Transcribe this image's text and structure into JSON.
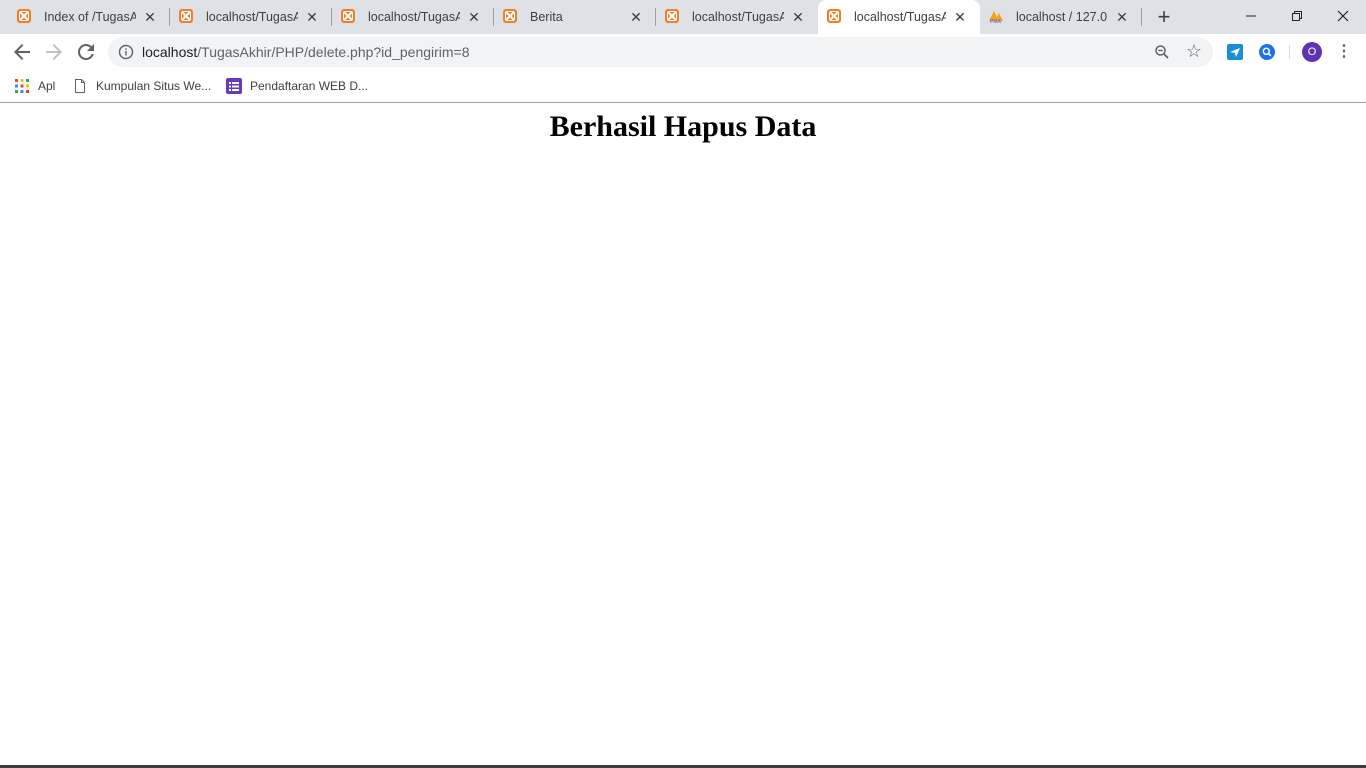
{
  "browser": {
    "tabs": [
      {
        "title": "Index of /TugasAkhir",
        "icon": "xampp-icon",
        "active": false
      },
      {
        "title": "localhost/TugasAkhir",
        "icon": "xampp-icon",
        "active": false
      },
      {
        "title": "localhost/TugasAkhir",
        "icon": "xampp-icon",
        "active": false
      },
      {
        "title": "Berita",
        "icon": "xampp-icon",
        "active": false
      },
      {
        "title": "localhost/TugasAkhir",
        "icon": "xampp-icon",
        "active": false
      },
      {
        "title": "localhost/TugasAkhir",
        "icon": "xampp-icon",
        "active": true
      },
      {
        "title": "localhost / 127.0.0.1",
        "icon": "phpmyadmin-icon",
        "active": false
      }
    ],
    "new_tab_label": "+",
    "address": {
      "host": "localhost",
      "path": "/TugasAkhir/PHP/delete.php?id_pengirim=8"
    },
    "profile_initial": "O",
    "bookmarks": [
      {
        "label": "Apl",
        "icon": "apps-grid-icon"
      },
      {
        "label": "Kumpulan Situs We...",
        "icon": "page-icon"
      },
      {
        "label": "Pendaftaran WEB D...",
        "icon": "form-icon"
      }
    ],
    "colors": {
      "tabstrip_bg": "#dee1e6",
      "xampp_orange": "#fb7a24",
      "avatar_purple": "#5e35b1"
    }
  },
  "page": {
    "heading": "Berhasil Hapus Data"
  }
}
